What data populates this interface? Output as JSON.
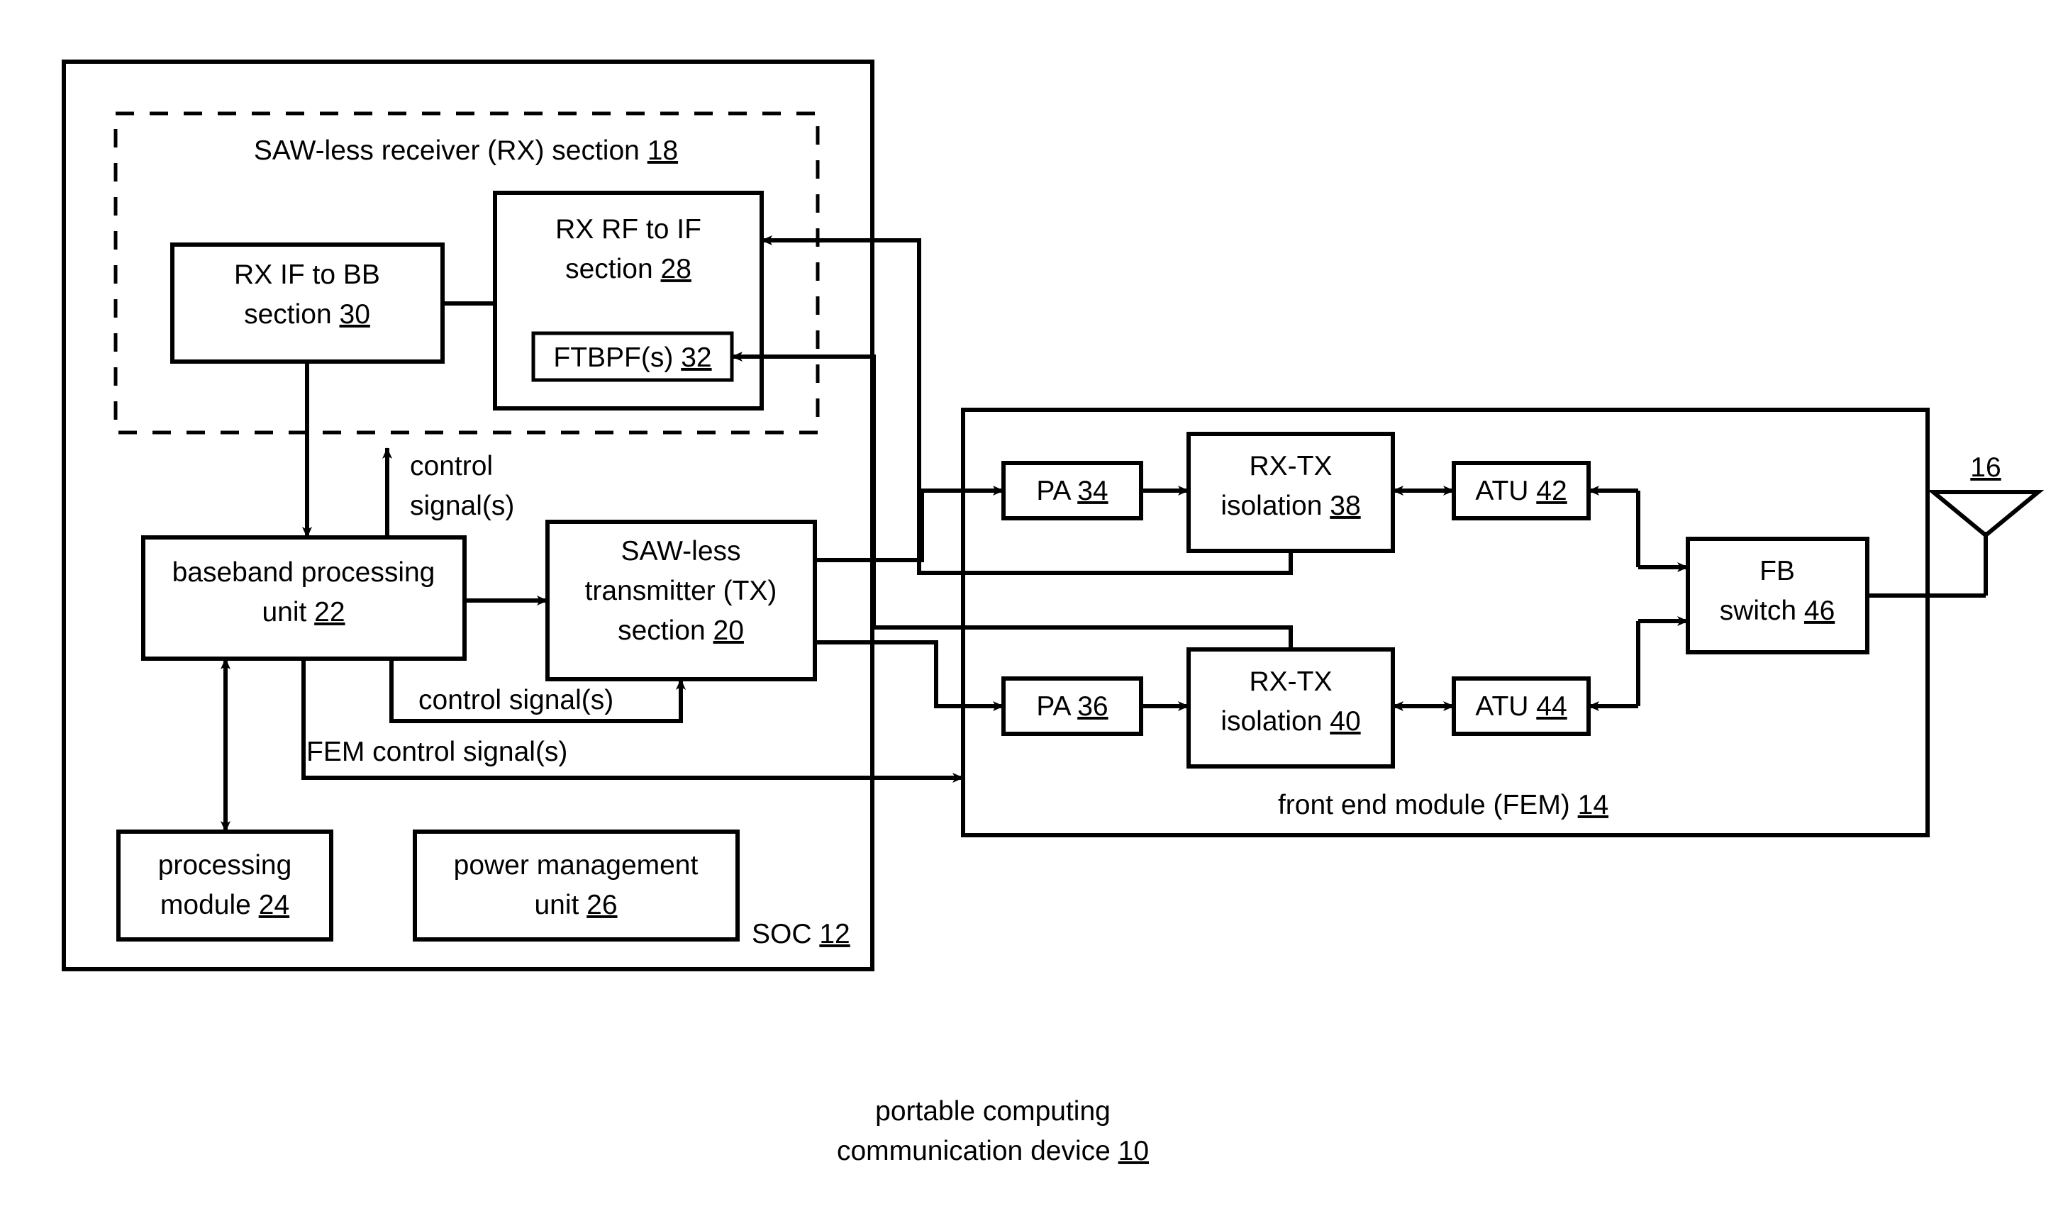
{
  "figure": {
    "caption_line1": "portable computing",
    "caption_line2": "communication device",
    "caption_ref": "10"
  },
  "soc": {
    "label": "SOC",
    "ref": "12",
    "rx_section": {
      "label": "SAW-less receiver (RX) section",
      "ref": "18",
      "blocks": [
        {
          "name": "rx-if-to-bb",
          "line1": "RX IF to BB",
          "line2": "section",
          "ref": "30"
        },
        {
          "name": "rx-rf-to-if",
          "line1": "RX RF to IF",
          "line2": "section",
          "ref": "28"
        },
        {
          "name": "ftbpf",
          "line1": "FTBPF(s)",
          "ref": "32"
        }
      ]
    },
    "baseband": {
      "line1": "baseband processing",
      "line2": "unit",
      "ref": "22"
    },
    "transmitter": {
      "line1": "SAW-less",
      "line2": "transmitter (TX)",
      "line3": "section",
      "ref": "20"
    },
    "processing_module": {
      "line1": "processing",
      "line2": "module",
      "ref": "24"
    },
    "power_management": {
      "line1": "power management",
      "line2": "unit",
      "ref": "26"
    },
    "signals": {
      "rx_control": {
        "line1": "control",
        "line2": "signal(s)"
      },
      "tx_control": "control signal(s)",
      "fem_control": "FEM control signal(s)"
    }
  },
  "fem": {
    "label": "front end module (FEM)",
    "ref": "14",
    "blocks": [
      {
        "name": "pa-34",
        "line1": "PA",
        "ref": "34"
      },
      {
        "name": "pa-36",
        "line1": "PA",
        "ref": "36"
      },
      {
        "name": "rx-tx-isolation-38",
        "line1": "RX-TX",
        "line2": "isolation",
        "ref": "38"
      },
      {
        "name": "rx-tx-isolation-40",
        "line1": "RX-TX",
        "line2": "isolation",
        "ref": "40"
      },
      {
        "name": "atu-42",
        "line1": "ATU",
        "ref": "42"
      },
      {
        "name": "atu-44",
        "line1": "ATU",
        "ref": "44"
      },
      {
        "name": "fb-switch-46",
        "line1": "FB",
        "line2": "switch",
        "ref": "46"
      }
    ]
  },
  "antenna": {
    "ref": "16"
  }
}
